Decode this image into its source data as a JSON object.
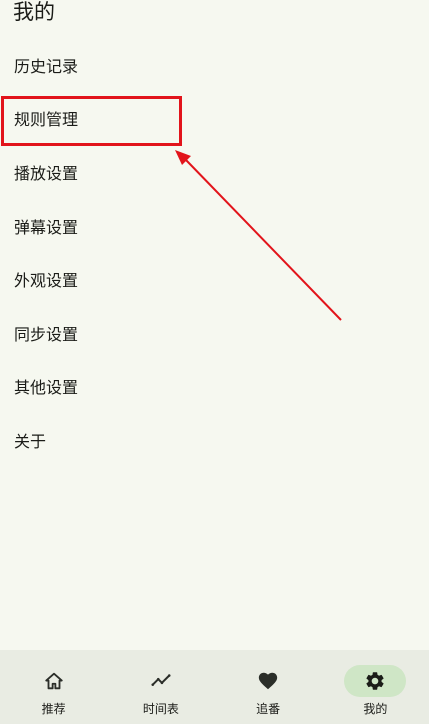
{
  "header": {
    "title": "我的"
  },
  "menu": {
    "items": [
      {
        "label": "历史记录"
      },
      {
        "label": "规则管理"
      },
      {
        "label": "播放设置"
      },
      {
        "label": "弹幕设置"
      },
      {
        "label": "外观设置"
      },
      {
        "label": "同步设置"
      },
      {
        "label": "其他设置"
      },
      {
        "label": "关于"
      }
    ]
  },
  "bottom_nav": {
    "items": [
      {
        "label": "推荐",
        "icon": "home-icon",
        "active": false
      },
      {
        "label": "时间表",
        "icon": "trend-line-icon",
        "active": false
      },
      {
        "label": "追番",
        "icon": "heart-icon",
        "active": false
      },
      {
        "label": "我的",
        "icon": "gear-icon",
        "active": true
      }
    ]
  },
  "colors": {
    "background": "#f6f8f0",
    "nav_background": "#e9ece3",
    "active_pill": "#cfe6c6",
    "annotation_red": "#e2141b",
    "text": "#1b1c18"
  }
}
